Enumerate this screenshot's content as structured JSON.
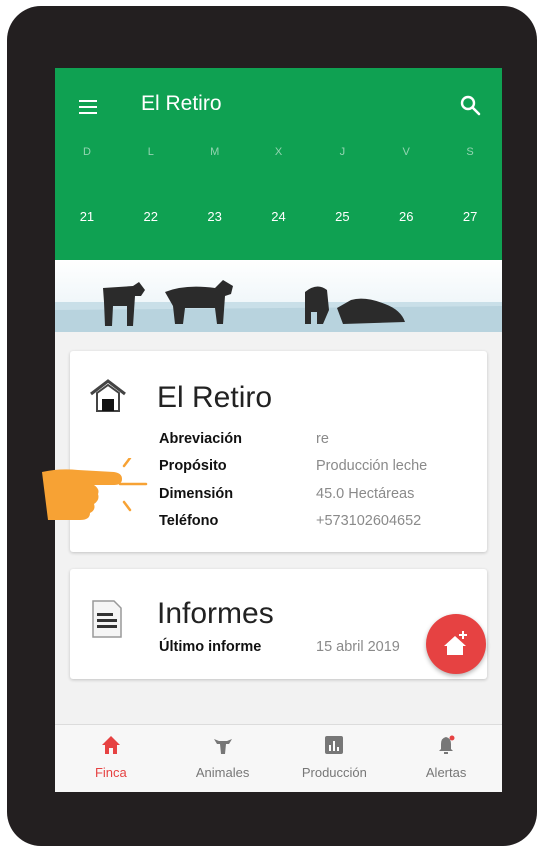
{
  "appbar": {
    "title": "El Retiro",
    "menu_icon": "menu-icon",
    "search_icon": "search-icon"
  },
  "calendar": {
    "day_letters": [
      "D",
      "L",
      "M",
      "X",
      "J",
      "V",
      "S"
    ],
    "day_numbers": [
      "21",
      "22",
      "23",
      "24",
      "25",
      "26",
      "27"
    ]
  },
  "farm_card": {
    "icon": "barn-icon",
    "title": "El Retiro",
    "rows": [
      {
        "label": "Abreviación",
        "value": "re"
      },
      {
        "label": "Propósito",
        "value": "Producción leche"
      },
      {
        "label": "Dimensión",
        "value": "45.0 Hectáreas"
      },
      {
        "label": "Teléfono",
        "value": "+573102604652"
      }
    ]
  },
  "reports_card": {
    "icon": "document-icon",
    "title": "Informes",
    "row": {
      "label": "Último informe",
      "value": "15 abril 2019"
    }
  },
  "fab": {
    "icon": "add-farm-icon"
  },
  "bottom_nav": [
    {
      "label": "Finca",
      "icon": "home-icon",
      "active": true
    },
    {
      "label": "Animales",
      "icon": "cow-icon",
      "active": false
    },
    {
      "label": "Producción",
      "icon": "chart-icon",
      "active": false
    },
    {
      "label": "Alertas",
      "icon": "bell-icon",
      "active": false
    }
  ],
  "colors": {
    "primary": "#0fa152",
    "accent": "#e64242",
    "pointer": "#f7a234"
  }
}
